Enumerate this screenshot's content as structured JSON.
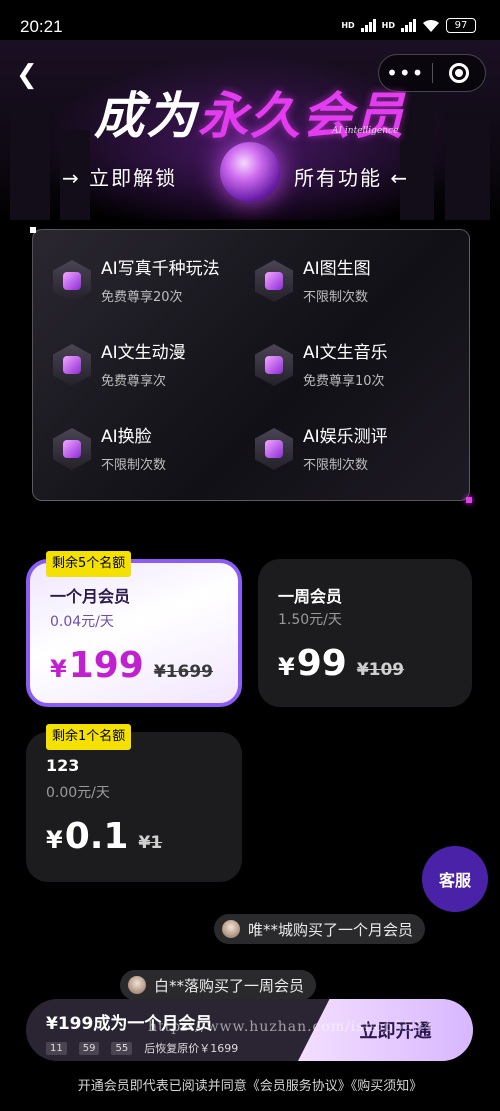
{
  "status_bar": {
    "time": "20:21",
    "network1": "HD",
    "network2": "HD",
    "battery": "97"
  },
  "header": {
    "title_white": "成为",
    "title_pink": "永久会员",
    "title_en": "AI intelligence",
    "sub_left": "→ 立即解锁",
    "sub_right": "所有功能 ←"
  },
  "features": [
    {
      "title": "AI写真千种玩法",
      "desc": "免费尊享20次",
      "icon": "camera-icon"
    },
    {
      "title": "AI图生图",
      "desc": "不限制次数",
      "icon": "image-icon"
    },
    {
      "title": "AI文生动漫",
      "desc": "免费尊享次",
      "icon": "anime-icon"
    },
    {
      "title": "AI文生音乐",
      "desc": "免费尊享10次",
      "icon": "music-icon"
    },
    {
      "title": "AI换脸",
      "desc": "不限制次数",
      "icon": "mask-icon"
    },
    {
      "title": "AI娱乐测评",
      "desc": "不限制次数",
      "icon": "phone-icon"
    }
  ],
  "plans": [
    {
      "badge": "剩余5个名额",
      "name": "一个月会员",
      "per_day": "0.04元/天",
      "currency": "¥",
      "price": "199",
      "original": "¥1699",
      "selected": true
    },
    {
      "badge": "",
      "name": "一周会员",
      "per_day": "1.50元/天",
      "currency": "¥",
      "price": "99",
      "original": "¥109",
      "selected": false
    },
    {
      "badge": "剩余1个名额",
      "name": "123",
      "per_day": "0.00元/天",
      "currency": "¥",
      "price": "0.1",
      "original": "¥1",
      "selected": false
    }
  ],
  "service_label": "客服",
  "notices": [
    {
      "text": "唯**城购买了一个月会员"
    },
    {
      "text": "白**落购买了一周会员"
    }
  ],
  "buybar": {
    "main": "¥199成为一个月会员",
    "countdown": [
      "11",
      "59",
      "55"
    ],
    "restore": "后恢复原价￥1699",
    "button": "立即开通"
  },
  "watermark": "https://www.huzhan.com/ishop5534",
  "agreement": "开通会员即代表已阅读并同意《会员服务协议》《购买须知》"
}
